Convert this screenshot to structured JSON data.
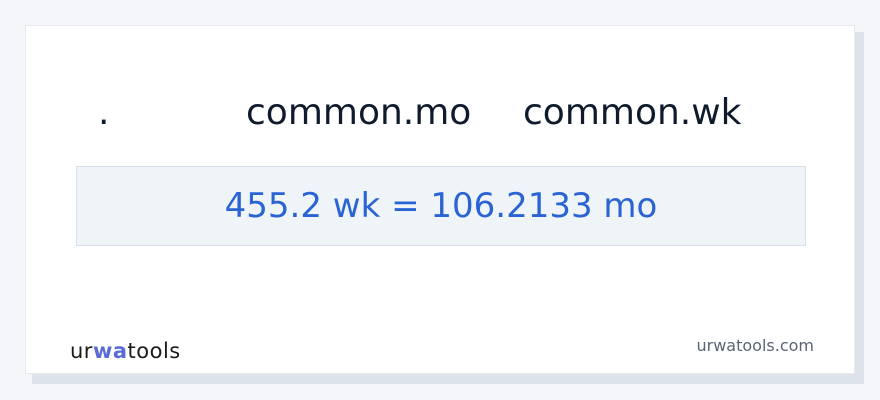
{
  "header": {
    "dot": ".",
    "from_unit": "common.mo",
    "to_unit": "common.wk"
  },
  "result": {
    "text": "455.2 wk = 106.2133 mo"
  },
  "logo": {
    "text_before": "ur",
    "text_accent": "wa",
    "text_after": "tools"
  },
  "footer": {
    "site": "urwatools.com"
  },
  "colors": {
    "result_text": "#2a63d3",
    "result_background": "#eff4f9",
    "logo_accent": "#5a6bd8"
  }
}
